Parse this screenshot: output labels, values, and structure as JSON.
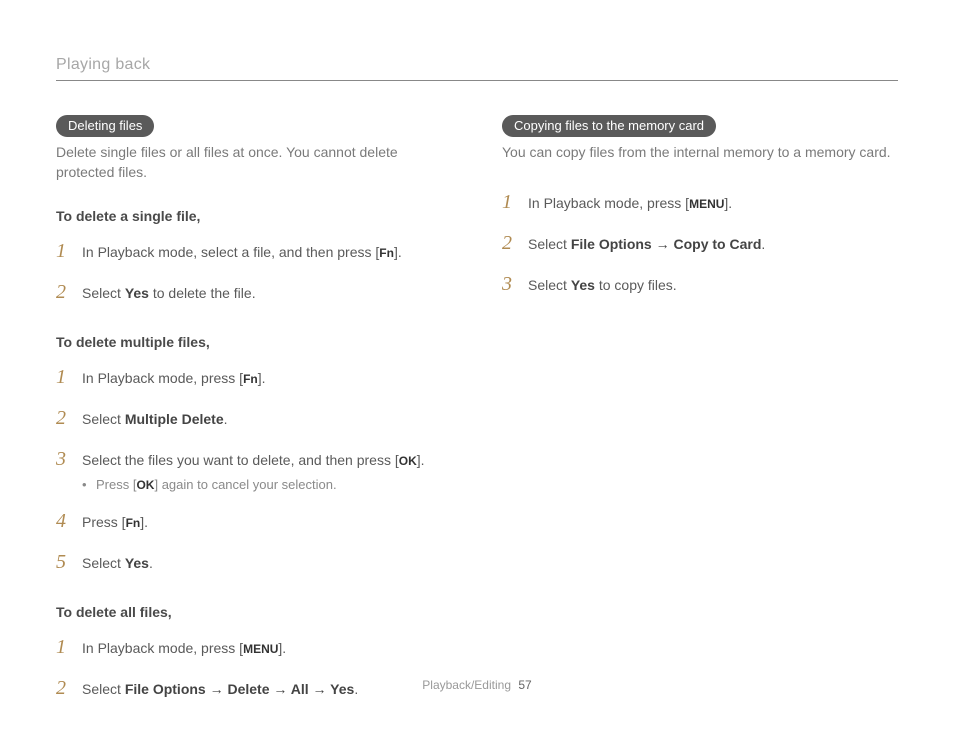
{
  "header": {
    "section_title": "Playing back"
  },
  "left": {
    "pill": "Deleting files",
    "intro": "Delete single files or all files at once. You cannot delete protected files.",
    "block1": {
      "subhead": "To delete a single file,",
      "steps": [
        {
          "pre": "In Playback mode, select a file, and then press [",
          "icon": "Fn",
          "post": "]."
        },
        {
          "pre": "Select ",
          "strong": "Yes",
          "post": " to delete the file."
        }
      ]
    },
    "block2": {
      "subhead": "To delete multiple files,",
      "steps": [
        {
          "pre": "In Playback mode, press [",
          "icon": "Fn",
          "post": "]."
        },
        {
          "pre": "Select ",
          "strong": "Multiple Delete",
          "post": "."
        },
        {
          "pre": "Select the files you want to delete, and then press [",
          "icon": "OK",
          "post": "].",
          "bullet": {
            "pre": "Press [",
            "icon": "OK",
            "post": "] again to cancel your selection."
          }
        },
        {
          "pre": "Press [",
          "icon": "Fn",
          "post": "]."
        },
        {
          "pre": "Select ",
          "strong": "Yes",
          "post": "."
        }
      ]
    },
    "block3": {
      "subhead": "To delete all files,",
      "steps": [
        {
          "pre": "In Playback mode, press [",
          "icon": "MENU",
          "post": "]."
        },
        {
          "pre": "Select ",
          "strong": "File Options → Delete → All → Yes",
          "post": "."
        }
      ]
    }
  },
  "right": {
    "pill": "Copying files to the memory card",
    "intro": "You can copy files from the internal memory to a memory card.",
    "steps": [
      {
        "pre": "In Playback mode, press [",
        "icon": "MENU",
        "post": "]."
      },
      {
        "pre": "Select ",
        "strong": "File Options → Copy to Card",
        "post": "."
      },
      {
        "pre": "Select ",
        "strong": "Yes",
        "post": " to copy files."
      }
    ]
  },
  "footer": {
    "label": "Playback/Editing",
    "page": "57"
  }
}
